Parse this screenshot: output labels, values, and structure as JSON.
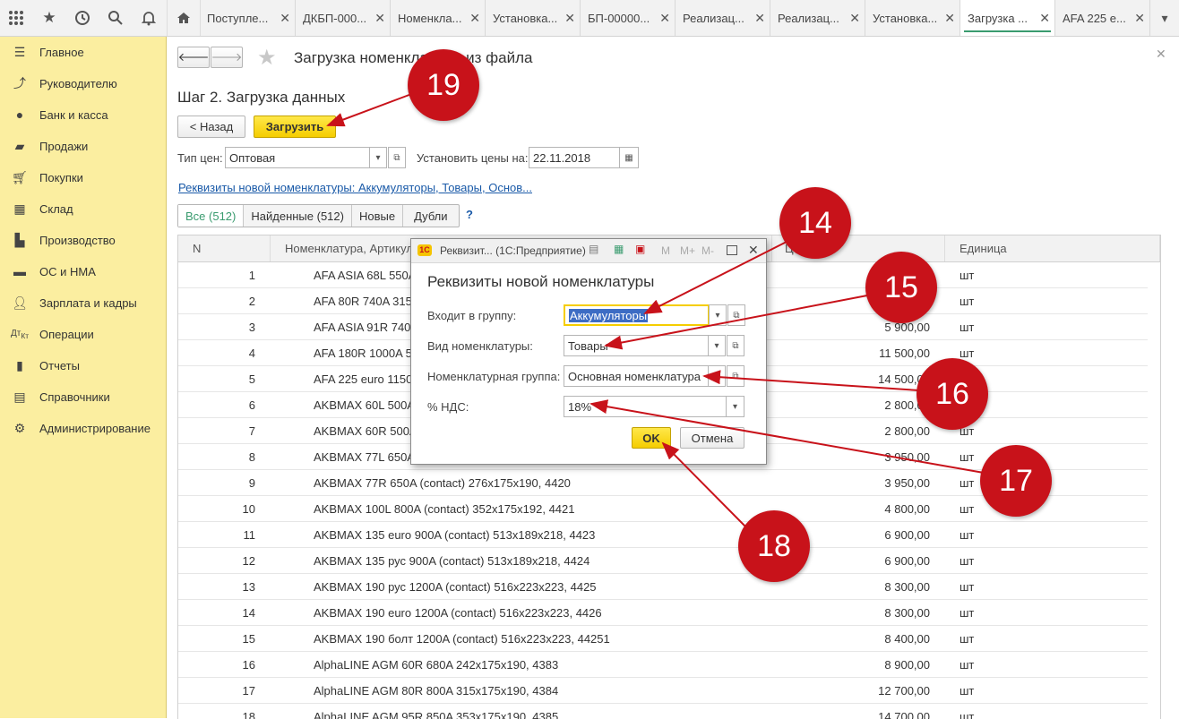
{
  "toolbar": {
    "icons": [
      "apps-grid-icon",
      "star-icon",
      "history-icon",
      "search-icon",
      "bell-icon"
    ],
    "home_icon": "home-icon"
  },
  "tabs": [
    {
      "label": "Поступле..."
    },
    {
      "label": "ДКБП-000..."
    },
    {
      "label": "Номенкла..."
    },
    {
      "label": "Установка..."
    },
    {
      "label": "БП-00000..."
    },
    {
      "label": "Реализац..."
    },
    {
      "label": "Реализац..."
    },
    {
      "label": "Установка..."
    },
    {
      "label": "Загрузка ..."
    },
    {
      "label": "AFA 225 e..."
    }
  ],
  "sidebar": {
    "items": [
      {
        "label": "Главное",
        "icon": "menu-icon"
      },
      {
        "label": "Руководителю",
        "icon": "trend-icon"
      },
      {
        "label": "Банк и касса",
        "icon": "coin-icon"
      },
      {
        "label": "Продажи",
        "icon": "bag-icon"
      },
      {
        "label": "Покупки",
        "icon": "cart-icon"
      },
      {
        "label": "Склад",
        "icon": "warehouse-icon"
      },
      {
        "label": "Производство",
        "icon": "factory-icon"
      },
      {
        "label": "ОС и НМА",
        "icon": "truck-icon"
      },
      {
        "label": "Зарплата и кадры",
        "icon": "person-icon"
      },
      {
        "label": "Операции",
        "icon": "operations-icon"
      },
      {
        "label": "Отчеты",
        "icon": "report-icon"
      },
      {
        "label": "Справочники",
        "icon": "book-icon"
      },
      {
        "label": "Администрирование",
        "icon": "gear-icon"
      }
    ]
  },
  "form": {
    "title": "Загрузка номенклатуры из файла",
    "step": "Шаг 2. Загрузка данных",
    "back_label": "< Назад",
    "load_label": "Загрузить",
    "price_type_label": "Тип цен:",
    "price_type_value": "Оптовая",
    "set_prices_label": "Установить цены на:",
    "set_prices_date": "22.11.2018",
    "requisites_link": "Реквизиты новой номенклатуры: Аккумуляторы, Товары, Основ...",
    "filters": [
      "Все (512)",
      "Найденные (512)",
      "Новые",
      "Дубли"
    ],
    "help": "?"
  },
  "grid": {
    "columns": [
      "N",
      "Номенклатура, Артикул",
      "Це",
      "Единица"
    ],
    "rows": [
      {
        "n": "1",
        "name": "AFA ASIA 68L 550A",
        "price": "",
        "unit": "шт"
      },
      {
        "n": "2",
        "name": "AFA 80R 740A 315",
        "price": "",
        "unit": "шт"
      },
      {
        "n": "3",
        "name": "AFA ASIA 91R 740",
        "price": "5 900,00",
        "unit": "шт"
      },
      {
        "n": "4",
        "name": "AFA 180R 1000A 5",
        "price": "11 500,00",
        "unit": "шт"
      },
      {
        "n": "5",
        "name": "AFA 225 euro 1150",
        "price": "14 500,00",
        "unit": "шт"
      },
      {
        "n": "6",
        "name": "AKBMAX 60L 500A",
        "price": "2 800,00",
        "unit": "шт"
      },
      {
        "n": "7",
        "name": "AKBMAX 60R 500A",
        "price": "2 800,00",
        "unit": "шт"
      },
      {
        "n": "8",
        "name": "AKBMAX 77L 650A",
        "price": "3 950,00",
        "unit": "шт"
      },
      {
        "n": "9",
        "name": "AKBMAX 77R 650A (contact) 276x175x190, 4420",
        "price": "3 950,00",
        "unit": "шт"
      },
      {
        "n": "10",
        "name": "AKBMAX 100L 800A (contact) 352x175x192, 4421",
        "price": "4 800,00",
        "unit": "шт"
      },
      {
        "n": "11",
        "name": "AKBMAX 135 euro 900A (contact) 513x189x218, 4423",
        "price": "6 900,00",
        "unit": "шт"
      },
      {
        "n": "12",
        "name": "AKBMAX 135 рус 900A (contact) 513x189x218, 4424",
        "price": "6 900,00",
        "unit": "шт"
      },
      {
        "n": "13",
        "name": "AKBMAX 190 рус 1200A (contact) 516x223x223, 4425",
        "price": "8 300,00",
        "unit": "шт"
      },
      {
        "n": "14",
        "name": "AKBMAX 190 euro 1200A (contact) 516x223x223, 4426",
        "price": "8 300,00",
        "unit": "шт"
      },
      {
        "n": "15",
        "name": "AKBMAX 190 болт 1200A (contact) 516x223x223, 44251",
        "price": "8 400,00",
        "unit": "шт"
      },
      {
        "n": "16",
        "name": "AlphaLINE AGM 60R 680A 242x175x190, 4383",
        "price": "8 900,00",
        "unit": "шт"
      },
      {
        "n": "17",
        "name": "AlphaLINE AGM 80R 800A 315x175x190, 4384",
        "price": "12 700,00",
        "unit": "шт"
      },
      {
        "n": "18",
        "name": "AlphaLINE AGM 95R 850A 353x175x190, 4385",
        "price": "14 700,00",
        "unit": "шт"
      }
    ]
  },
  "dialog": {
    "title": "Реквизит... (1С:Предприятие)",
    "title_tools": [
      "M",
      "M+",
      "M-"
    ],
    "heading": "Реквизиты новой номенклатуры",
    "group_label": "Входит в группу:",
    "group_value": "Аккумуляторы",
    "kind_label": "Вид номенклатуры:",
    "kind_value": "Товары",
    "nomgroup_label": "Номенклатурная группа:",
    "nomgroup_value": "Основная номенклатура",
    "vat_label": "% НДС:",
    "vat_value": "18%",
    "ok_label": "OK",
    "cancel_label": "Отмена"
  },
  "markers": [
    "19",
    "14",
    "15",
    "16",
    "17",
    "18"
  ],
  "colors": {
    "sidebar": "#fbeea0",
    "accent_yellow": "#f5cd00",
    "marker_red": "#c8121a",
    "link": "#1a5aa8"
  }
}
